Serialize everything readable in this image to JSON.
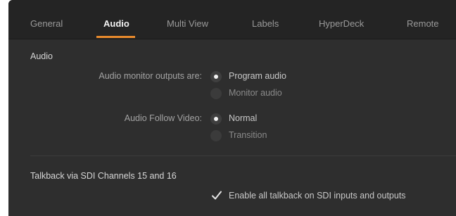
{
  "tabs": [
    {
      "label": "General",
      "active": false
    },
    {
      "label": "Audio",
      "active": true
    },
    {
      "label": "Multi View",
      "active": false
    },
    {
      "label": "Labels",
      "active": false
    },
    {
      "label": "HyperDeck",
      "active": false
    },
    {
      "label": "Remote",
      "active": false
    }
  ],
  "accent_color": "#e98a2c",
  "audio": {
    "title": "Audio",
    "monitor_outputs": {
      "label": "Audio monitor outputs are:",
      "options": [
        "Program audio",
        "Monitor audio"
      ],
      "selected": "Program audio"
    },
    "follow_video": {
      "label": "Audio Follow Video:",
      "options": [
        "Normal",
        "Transition"
      ],
      "selected": "Normal"
    }
  },
  "talkback": {
    "title": "Talkback via SDI Channels 15 and 16",
    "checkbox_label": "Enable all talkback on SDI inputs and outputs",
    "checked": true
  }
}
